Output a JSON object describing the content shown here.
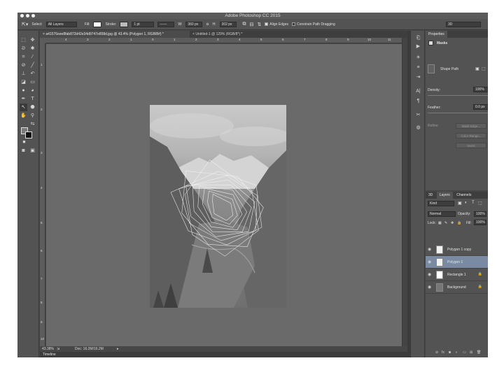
{
  "app": {
    "title": "Adobe Photoshop CC 2015"
  },
  "options_bar": {
    "select_label": "Select:",
    "select_value": "All Layers",
    "fill_label": "Fill:",
    "stroke_label": "Stroke:",
    "stroke_width": "1 pt",
    "w_label": "W:",
    "w_value": "360 px",
    "h_label": "H:",
    "h_value": "302 px",
    "align_edges": "Align Edges",
    "constrain_path": "Constrain Path Dragging",
    "workspace": "3D"
  },
  "doc_tabs": [
    {
      "label": "a41576eee8fab872d42e34d9747e858d.jpg @ 43.4% (Polygon 1, RGB/8#) *"
    },
    {
      "label": "Untitled-1 @ 129% (RGB/8*) *"
    }
  ],
  "ruler_top": [
    "4",
    "3",
    "2",
    "1",
    "0",
    "1",
    "2",
    "3",
    "4",
    "5",
    "6",
    "7",
    "8",
    "9",
    "10",
    "11"
  ],
  "ruler_left": [
    "1",
    "2",
    "3",
    "4",
    "5",
    "6",
    "7",
    "8",
    "9",
    "10"
  ],
  "status": {
    "zoom": "43.38%",
    "doc": "Doc: 16.2M/16.2M"
  },
  "timeline": {
    "label": "Timeline"
  },
  "properties": {
    "tab": "Properties",
    "masks_title": "Masks",
    "shape_path": "Shape Path",
    "density_label": "Density:",
    "density_value": "100%",
    "feather_label": "Feather:",
    "feather_value": "0.0 px",
    "refine_label": "Refine:",
    "mask_edge": "Mask Edge...",
    "color_range": "Color Range...",
    "invert": "Invert"
  },
  "layers_panel": {
    "tabs": [
      "3D",
      "Layers",
      "Channels"
    ],
    "kind_filter": "Kind",
    "blend_mode": "Normal",
    "opacity_label": "Opacity:",
    "opacity_value": "100%",
    "lock_label": "Lock:",
    "fill_label": "Fill:",
    "fill_value": "100%",
    "layers": [
      {
        "name": "Polygon 1 copy",
        "selected": false
      },
      {
        "name": "Polygon 1",
        "selected": true
      },
      {
        "name": "Rectangle 1",
        "selected": false
      },
      {
        "name": "Background",
        "selected": false
      }
    ]
  },
  "colors": {
    "accent": "#7a8aa3",
    "panel": "#535353",
    "canvas": "#6a6a6a"
  }
}
